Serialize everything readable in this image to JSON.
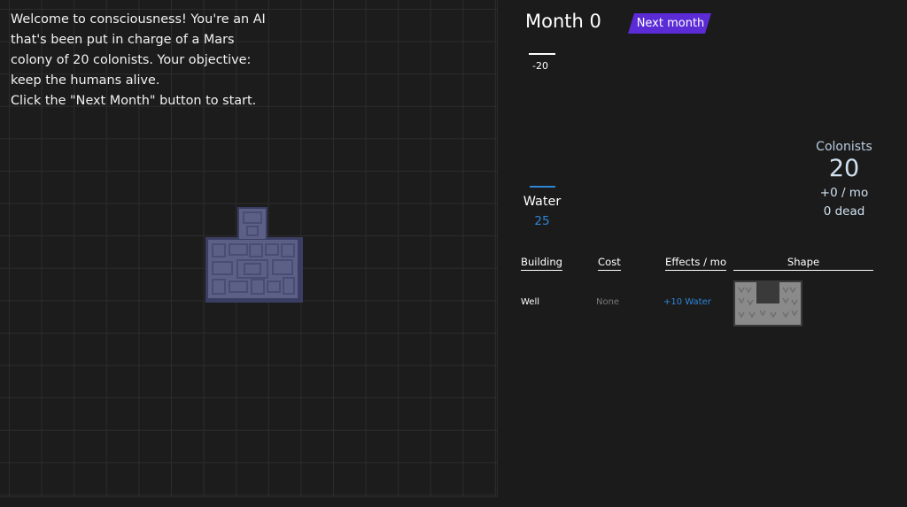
{
  "intro": {
    "lines": [
      "Welcome to consciousness! You're an AI",
      "that's been put in charge of a Mars",
      "colony of 20 colonists. Your objective:",
      "keep the humans alive.",
      "Click the \"Next Month\" button to start."
    ]
  },
  "header": {
    "month_title": "Month 0",
    "next_button": "Next month"
  },
  "resource_chart": {
    "tick_label": "-20"
  },
  "colonists": {
    "label": "Colonists",
    "count": "20",
    "rate": "+0 / mo",
    "dead": "0 dead"
  },
  "water": {
    "label": "Water",
    "value": "25"
  },
  "buildings_table": {
    "headers": {
      "building": "Building",
      "cost": "Cost",
      "effects": "Effects / mo",
      "shape": "Shape"
    },
    "rows": [
      {
        "building": "Well",
        "cost": "None",
        "effects": "+10 Water",
        "shape_icon": "well-shape-icon"
      }
    ]
  },
  "colors": {
    "accent": "#5b2bd6",
    "water": "#2d86d8",
    "colonists": "#cfe0ef",
    "map_building": "#5c5f86",
    "shape_gray": "#8a8a8a"
  }
}
